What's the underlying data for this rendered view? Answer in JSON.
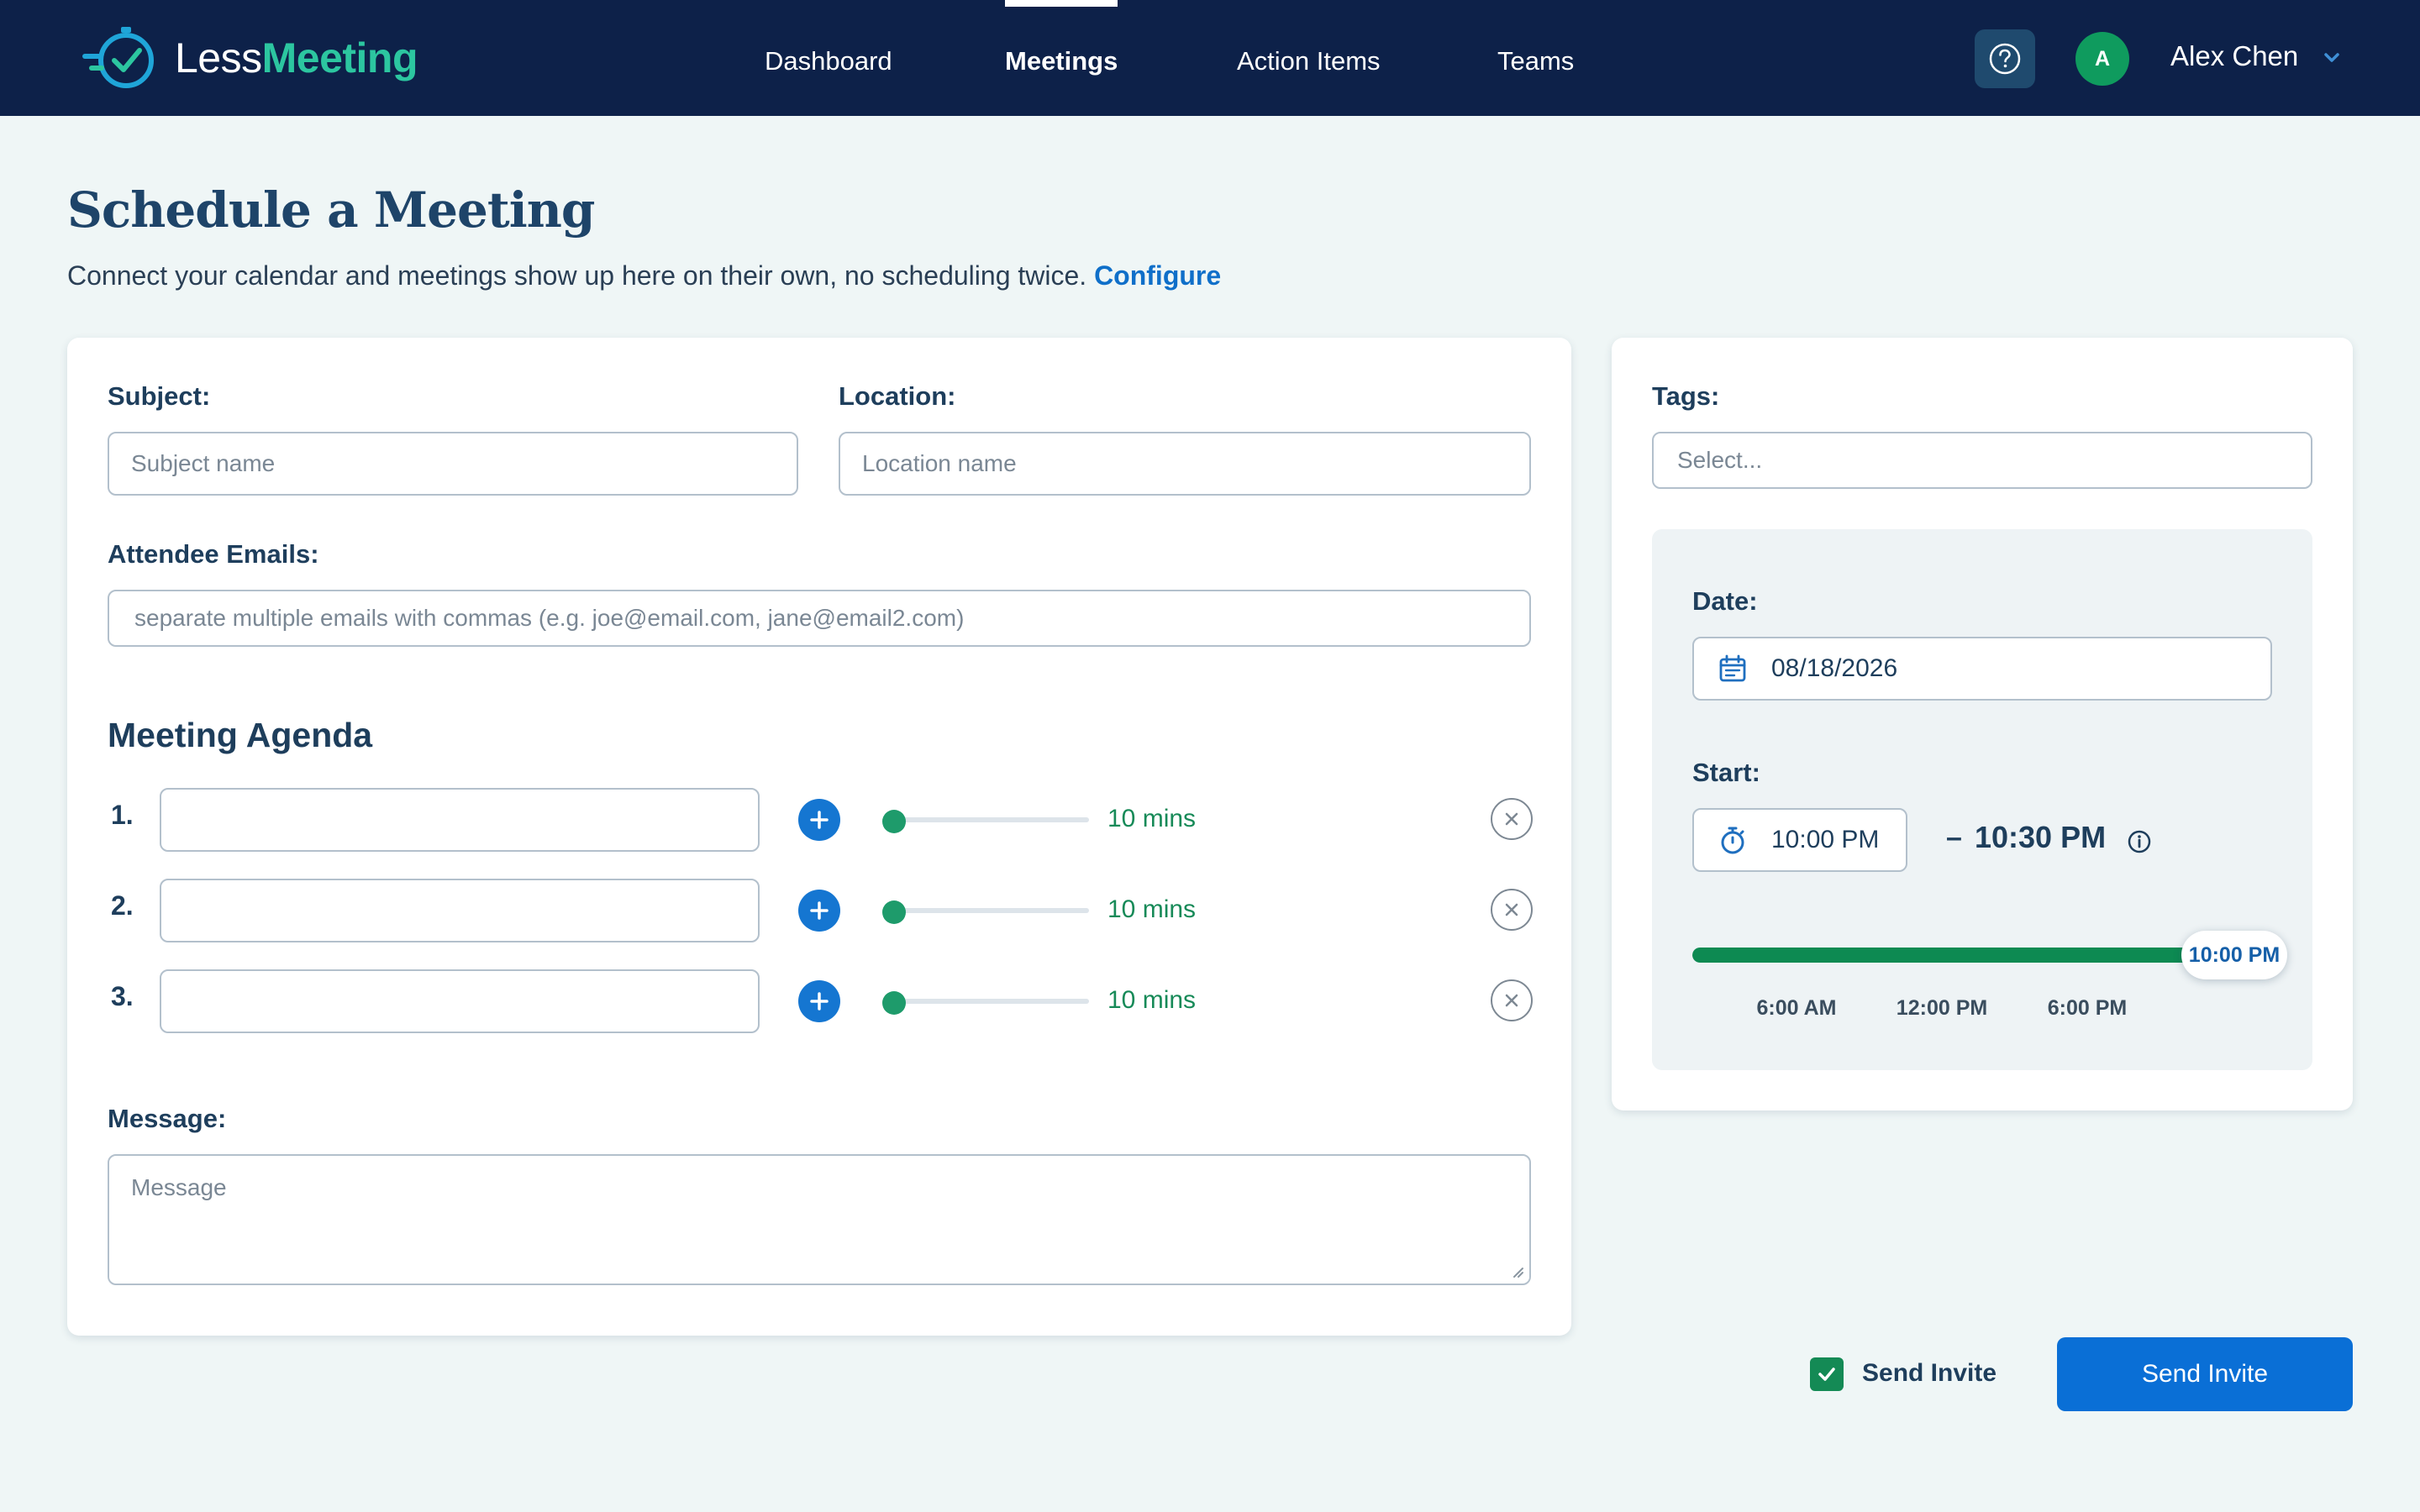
{
  "app": {
    "logo_part1": "Less",
    "logo_part2": "Meeting",
    "brand_color": "#0d2149",
    "accent_color": "#2cc6a0"
  },
  "nav": {
    "items": [
      {
        "label": "Dashboard",
        "active": false
      },
      {
        "label": "Meetings",
        "active": true
      },
      {
        "label": "Action Items",
        "active": false
      },
      {
        "label": "Teams",
        "active": false
      }
    ]
  },
  "user": {
    "help_icon": "question-icon",
    "avatar_initial": "A",
    "name": "Alex Chen"
  },
  "page": {
    "title": "Schedule a Meeting",
    "subtitle": "Connect your calendar and meetings show up here on their own, no scheduling twice.",
    "subtitle_link": "Configure"
  },
  "form": {
    "subject_label": "Subject:",
    "subject_placeholder": "Subject name",
    "location_label": "Location:",
    "location_placeholder": "Location name",
    "attendees_label": "Attendee Emails:",
    "attendees_placeholder": "separate multiple emails with commas (e.g. joe@email.com, jane@email2.com)",
    "agenda_title": "Meeting Agenda",
    "agenda": [
      {
        "number": "1.",
        "duration": "10 mins"
      },
      {
        "number": "2.",
        "duration": "10 mins"
      },
      {
        "number": "3.",
        "duration": "10 mins"
      }
    ],
    "message_label": "Message:",
    "message_placeholder": "Message"
  },
  "side": {
    "tags_label": "Tags:",
    "tags_placeholder": "Select...",
    "date_label": "Date:",
    "date_value": "08/18/2026",
    "start_label": "Start:",
    "start_value": "10:00 PM",
    "dash": "–",
    "end_value": "10:30 PM",
    "range_value": "10:00 PM",
    "range_fill_fraction": 0.97,
    "ticks": [
      "6:00 AM",
      "12:00 PM",
      "6:00 PM"
    ]
  },
  "footer": {
    "send_invite_checked": true,
    "checkbox_label": "Send Invite",
    "button_label": "Send Invite"
  }
}
